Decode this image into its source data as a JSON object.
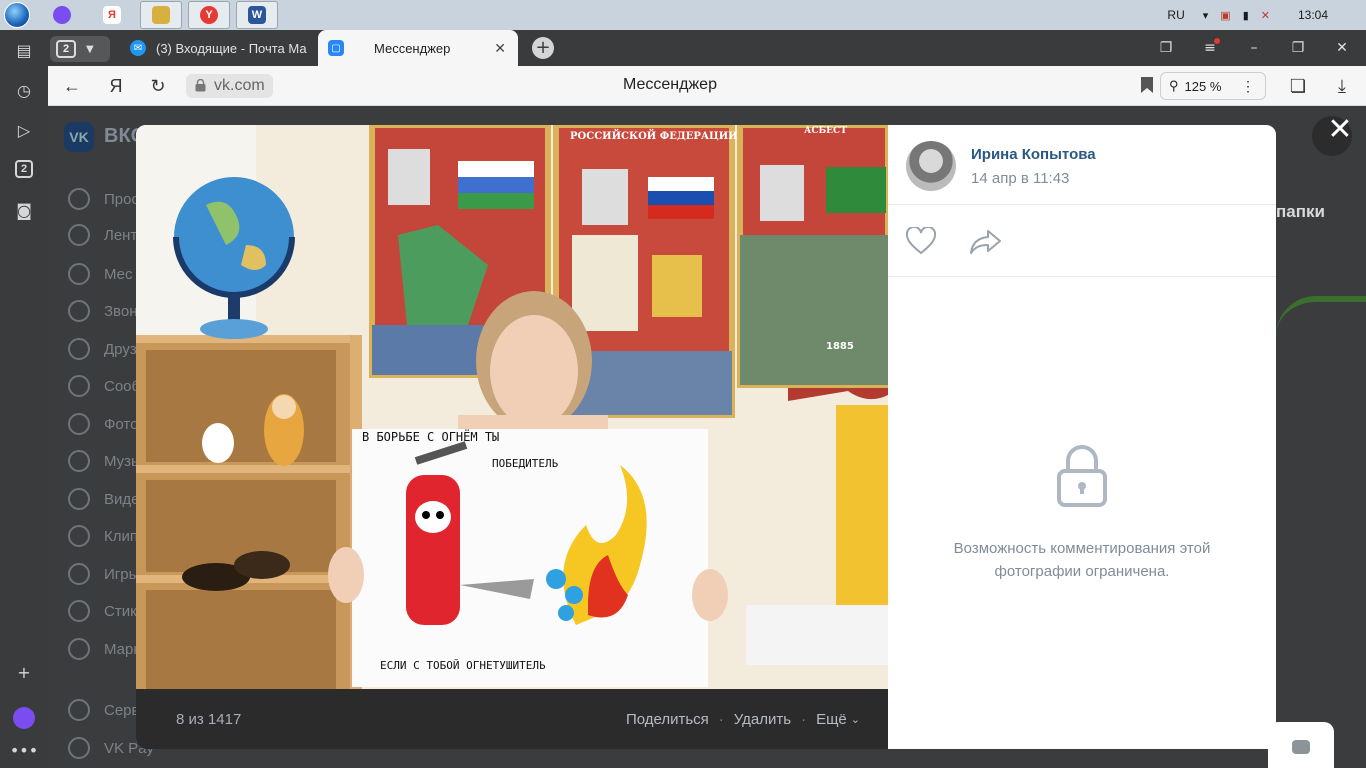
{
  "taskbar": {
    "language": "RU",
    "clock": "13:04",
    "apps": [
      {
        "name": "alice",
        "color": "#7b4cf0",
        "glyph": ""
      },
      {
        "name": "yandex",
        "color": "#ffffff",
        "glyph": "Я"
      },
      {
        "name": "explorer",
        "color": "#d8b040",
        "glyph": ""
      },
      {
        "name": "yandex-browser",
        "color": "#e53935",
        "glyph": "Y"
      },
      {
        "name": "word",
        "color": "#2b579a",
        "glyph": "W"
      }
    ]
  },
  "browser": {
    "tab_count": "2",
    "tabs": [
      {
        "title": "(3) Входящие - Почта Ма",
        "icon": "mail-icon",
        "active": false
      },
      {
        "title": "Мессенджер",
        "icon": "vk-messenger-icon",
        "active": true
      }
    ],
    "url": "vk.com",
    "page_title": "Мессенджер",
    "zoom": "125 %"
  },
  "vk_background": {
    "brand": "ВКО",
    "menu": [
      "Прос",
      "Лент",
      "Мес",
      "Звон",
      "Друз",
      "Сооб",
      "Фото",
      "Музы",
      "Виде",
      "Клип",
      "Игры",
      "Стик",
      "Марк",
      "Серв",
      "VK Pay"
    ],
    "folders_label": "папки"
  },
  "viewer": {
    "author_name": "Ирина Копытова",
    "date": "14 апр в 11:43",
    "counter": "8 из 1417",
    "actions": [
      "Поделиться",
      "Удалить",
      "Ещё"
    ],
    "comments_locked_text": "Возможность комментирования этой фотографии ограничена.",
    "photo": {
      "poster_text_top": "В БОРЬБЕ С ОГНЁМ ТЫ",
      "poster_text_mid": "ПОБЕДИТЕЛЬ",
      "poster_text_bottom": "ЕСЛИ С ТОБОЙ ОГНЕТУШИТЕЛЬ",
      "stand_header": "РОССИЙСКОЙ ФЕДЕРАЦИИ",
      "stand_right": "АСБЕСТ",
      "stand_year": "1885"
    }
  },
  "colors": {
    "accent": "#2a5885",
    "muted": "#818c99",
    "dark_bar": "#2b2b2c"
  }
}
